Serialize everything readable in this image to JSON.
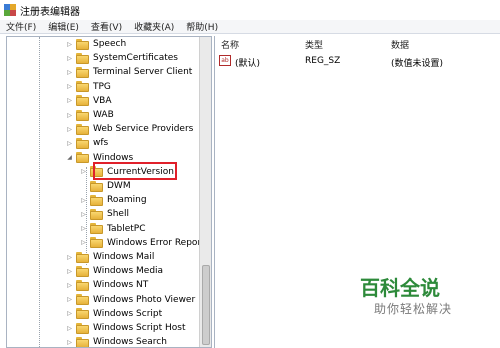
{
  "window": {
    "title": "注册表编辑器"
  },
  "menu": [
    "文件(F)",
    "编辑(E)",
    "查看(V)",
    "收藏夹(A)",
    "帮助(H)"
  ],
  "tree": {
    "items": [
      {
        "label": "Speech",
        "level": 0,
        "expander": "right"
      },
      {
        "label": "SystemCertificates",
        "level": 0,
        "expander": "right"
      },
      {
        "label": "Terminal Server Client",
        "level": 0,
        "expander": "right"
      },
      {
        "label": "TPG",
        "level": 0,
        "expander": "right"
      },
      {
        "label": "VBA",
        "level": 0,
        "expander": "right"
      },
      {
        "label": "WAB",
        "level": 0,
        "expander": "right"
      },
      {
        "label": "Web Service Providers",
        "level": 0,
        "expander": "right"
      },
      {
        "label": "wfs",
        "level": 0,
        "expander": "right"
      },
      {
        "label": "Windows",
        "level": 0,
        "expander": "down"
      },
      {
        "label": "CurrentVersion",
        "level": 1,
        "expander": "right",
        "highlighted": true
      },
      {
        "label": "DWM",
        "level": 1,
        "expander": "none"
      },
      {
        "label": "Roaming",
        "level": 1,
        "expander": "right"
      },
      {
        "label": "Shell",
        "level": 1,
        "expander": "right"
      },
      {
        "label": "TabletPC",
        "level": 1,
        "expander": "right"
      },
      {
        "label": "Windows Error Reportin",
        "level": 1,
        "expander": "right"
      },
      {
        "label": "Windows Mail",
        "level": 0,
        "expander": "right"
      },
      {
        "label": "Windows Media",
        "level": 0,
        "expander": "right"
      },
      {
        "label": "Windows NT",
        "level": 0,
        "expander": "right"
      },
      {
        "label": "Windows Photo Viewer",
        "level": 0,
        "expander": "right"
      },
      {
        "label": "Windows Script",
        "level": 0,
        "expander": "right"
      },
      {
        "label": "Windows Script Host",
        "level": 0,
        "expander": "right"
      },
      {
        "label": "Windows Search",
        "level": 0,
        "expander": "right"
      }
    ]
  },
  "list": {
    "headers": {
      "name": "名称",
      "type": "类型",
      "data": "数据"
    },
    "rows": [
      {
        "icon": "ab",
        "name": "(默认)",
        "type": "REG_SZ",
        "data": "(数值未设置)"
      }
    ]
  },
  "watermark": {
    "title": "百科全说",
    "subtitle": "助你轻松解决"
  },
  "colors": {
    "highlight": "#e0202a",
    "watermark": "#2d8a3a",
    "folder": "#e6b23a"
  }
}
